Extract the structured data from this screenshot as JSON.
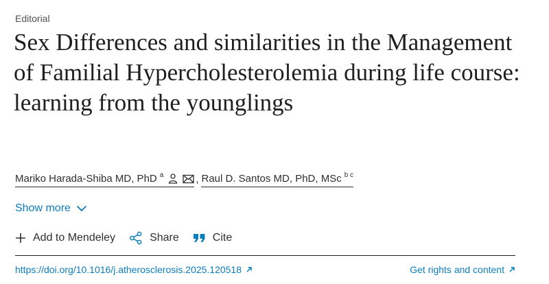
{
  "article": {
    "type": "Editorial",
    "title": "Sex Differences and similarities in the Management of Familial Hypercholesterolemia during life course: learning from the younglings"
  },
  "authors": [
    {
      "name": "Mariko Harada-Shiba MD, PhD",
      "affiliation": "a"
    },
    {
      "name": "Raul D. Santos MD, PhD, MSc",
      "affiliation": "b c"
    }
  ],
  "author_separator": ",",
  "show_more": {
    "label": "Show more"
  },
  "actions": {
    "mendeley": "Add to Mendeley",
    "share": "Share",
    "cite": "Cite"
  },
  "footer": {
    "doi": "https://doi.org/10.1016/j.atherosclerosis.2025.120518",
    "rights": "Get rights and content"
  },
  "colors": {
    "link": "#0c7dbb",
    "text": "#1f1f1f"
  },
  "icons": [
    "person-icon",
    "envelope-icon",
    "chevron-down-icon",
    "plus-icon",
    "share-icon",
    "quote-icon",
    "external-link-icon"
  ]
}
